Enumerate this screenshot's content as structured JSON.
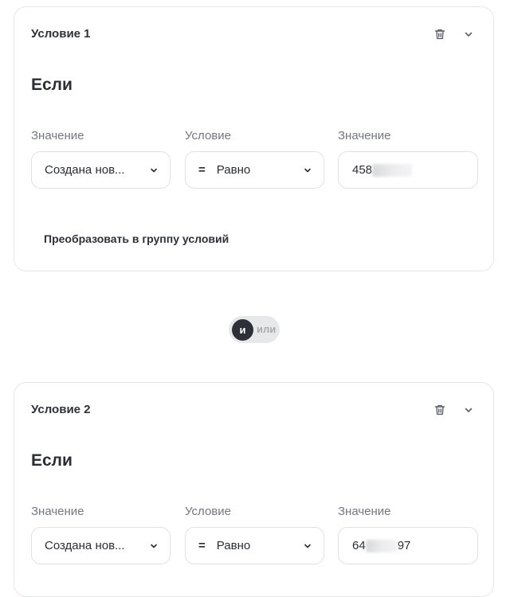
{
  "conditions": [
    {
      "title": "Условие 1",
      "if_label": "Если",
      "fields": {
        "field_label": "Значение",
        "field_value": "Создана нов...",
        "operator_label": "Условие",
        "operator_symbol": "=",
        "operator_value": "Равно",
        "value_label": "Значение",
        "value_visible_start": "458",
        "value_visible_end": ""
      },
      "convert_link": "Преобразовать в группу условий"
    },
    {
      "title": "Условие 2",
      "if_label": "Если",
      "fields": {
        "field_label": "Значение",
        "field_value": "Создана нов...",
        "operator_label": "Условие",
        "operator_symbol": "=",
        "operator_value": "Равно",
        "value_label": "Значение",
        "value_visible_start": "64",
        "value_visible_end": "97"
      }
    }
  ],
  "logic_toggle": {
    "selected": "и",
    "other": "или"
  },
  "icons": {
    "delete": "trash-icon",
    "collapse": "chevron-down-icon",
    "dropdown": "chevron-down-icon"
  },
  "colors": {
    "toggle_active": "#2e3038",
    "toggle_track": "#e7e8ea",
    "border": "#e6e7ea",
    "muted_text": "#74777f"
  }
}
